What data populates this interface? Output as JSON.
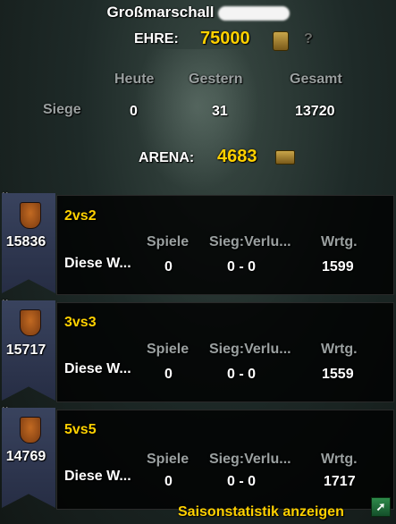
{
  "header": {
    "title": "Großmarschall",
    "honor_label": "EHRE:",
    "honor_value": "75000",
    "help_icon": "?",
    "columns": [
      "Heute",
      "Gestern",
      "Gesamt"
    ],
    "row_label": "Siege",
    "row_values": [
      "0",
      "31",
      "13720"
    ],
    "arena_label": "ARENA:",
    "arena_value": "4683"
  },
  "teams": [
    {
      "bracket": "2vs2",
      "team_rating": "15836",
      "row_label": "Diese W...",
      "headers": [
        "Spiele",
        "Sieg:Verlu...",
        "Wrtg."
      ],
      "games": "0",
      "win_loss": "0 - 0",
      "rating": "1599"
    },
    {
      "bracket": "3vs3",
      "team_rating": "15717",
      "row_label": "Diese W...",
      "headers": [
        "Spiele",
        "Sieg:Verlu...",
        "Wrtg."
      ],
      "games": "0",
      "win_loss": "0 - 0",
      "rating": "1559"
    },
    {
      "bracket": "5vs5",
      "team_rating": "14769",
      "row_label": "Diese W...",
      "headers": [
        "Spiele",
        "Sieg:Verlu...",
        "Wrtg."
      ],
      "games": "0",
      "win_loss": "0 - 0",
      "rating": "1717"
    }
  ],
  "footer": {
    "season_stats_label": "Saisonstatistik anzeigen"
  },
  "colors": {
    "gold": "#ffd100",
    "grey": "#9aa0a0",
    "banner": "#39435e"
  }
}
